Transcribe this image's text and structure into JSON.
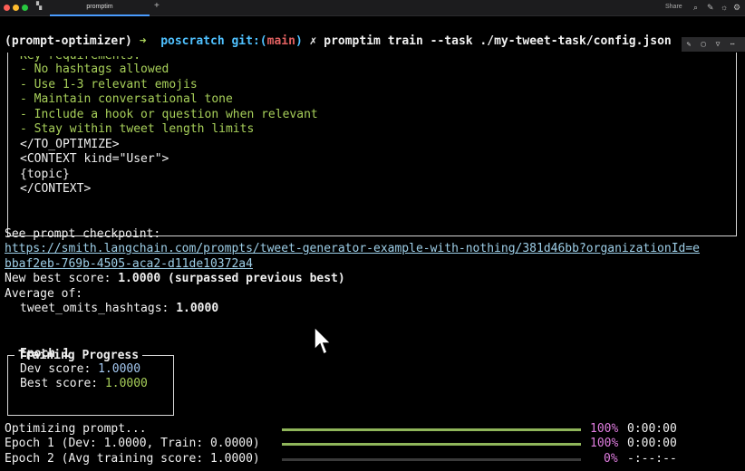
{
  "window": {
    "tab_title": "promptim",
    "share_label": "Share"
  },
  "terminal": {
    "env": "(prompt-optimizer)",
    "arrow": "➜",
    "dir": "poscratch",
    "git_prefix": "git:(",
    "branch": "main",
    "git_suffix": ")",
    "dirty": "✗",
    "command": "promptim train --task ./my-tweet-task/config.json",
    "prompt_lines": [
      "Key requirements:",
      "- No hashtags allowed",
      "- Use 1-3 relevant emojis",
      "- Maintain conversational tone",
      "- Include a hook or question when relevant",
      "- Stay within tweet length limits",
      "</TO_OPTIMIZE>",
      "<CONTEXT kind=\"User\">",
      "{topic}",
      "</CONTEXT>"
    ],
    "checkpoint_label": "See prompt checkpoint:",
    "checkpoint_url_1": "https://smith.langchain.com/prompts/tweet-generator-example-with-nothing/381d46bb?organizationId=e",
    "checkpoint_url_2": "bbaf2eb-769b-4505-aca2-d11de10372a4",
    "best_prefix": "New best score: ",
    "best_value": "1.0000",
    "best_suffix": " (surpassed previous best)",
    "average_label": "Average of:",
    "metric_name": "tweet_omits_hashtags: ",
    "metric_value": "1.0000"
  },
  "training": {
    "title": "Training Progress",
    "epoch": "Epoch 1",
    "dev_label": "Dev score: ",
    "dev_value": "1.0000",
    "best_label": "Best score: ",
    "best_value": "1.0000"
  },
  "progress_rows": [
    {
      "label": "Optimizing prompt...",
      "fraction": 1.0,
      "pct": "100%",
      "time": "0:00:00"
    },
    {
      "label": "Epoch 1 (Dev: 1.0000, Train: 0.0000)",
      "fraction": 1.0,
      "pct": "100%",
      "time": "0:00:00"
    },
    {
      "label": "Epoch 2 (Avg training score: 1.0000)",
      "fraction": 0.0,
      "pct": "0%",
      "time": "-:--:--"
    }
  ],
  "colors": {
    "bar_fill": "#8fb55a",
    "bar_empty": "#3a3a3a",
    "accent": "#4a9cff"
  }
}
